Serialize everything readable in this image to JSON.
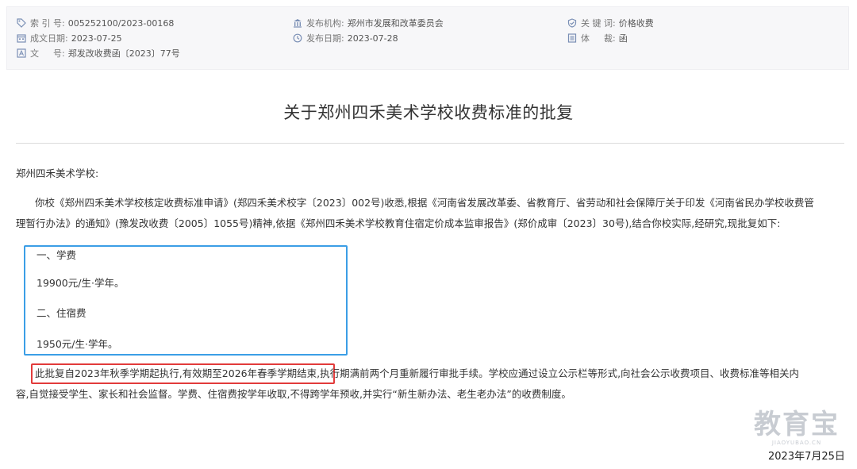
{
  "meta": {
    "index_label": "索 引 号:",
    "index_value": "005252100/2023-00168",
    "publisher_label": "发布机构:",
    "publisher_value": "郑州市发展和改革委员会",
    "keyword_label": "关 键 词:",
    "keyword_value": "价格收费",
    "created_label": "成文日期:",
    "created_value": "2023-07-25",
    "published_label": "发布日期:",
    "published_value": "2023-07-28",
    "genre_label": "体 　 裁:",
    "genre_value": "函",
    "docno_label": "文 　 号:",
    "docno_value": "郑发改收费函〔2023〕77号"
  },
  "doc": {
    "title": "关于郑州四禾美术学校收费标准的批复",
    "salutation": "郑州四禾美术学校:",
    "intro_line1": "你校《郑州四禾美术学校核定收费标准申请》(郑四禾美术校字〔2023〕002号)收悉,根据《河南省发展改革委、省教育厅、省劳动和社会保障厅关于印发《河南省民办学校收费管",
    "intro_line2": "理暂行办法》的通知》(豫发改收费〔2005〕1055号)精神,依据《郑州四禾美术学校教育住宿定价成本监审报告》(郑价成审〔2023〕30号),结合你校实际,经研究,现批复如下:",
    "fee1_heading": "一、学费",
    "fee1_value": "19900元/生·学年。",
    "fee2_heading": "二、住宿费",
    "fee2_value": "1950元/生·学年。",
    "validity_highlight": "此批复自2023年秋季学期起执行,有效期至2026年春季学期结束,",
    "validity_rest": "执行期满前两个月重新履行审批手续。学校应通过设立公示栏等形式,向社会公示收费项目、收费标准等相关内",
    "validity_line2": "容,自觉接受学生、家长和社会监督。学费、住宿费按学年收取,不得跨学年预收,并实行“新生新办法、老生老办法”的收费制度。",
    "date": "2023年7月25日"
  },
  "watermark": {
    "text": "教育宝",
    "sub": "JIAOYUBAO.CN"
  },
  "colors": {
    "icon": "#7a8fb5",
    "highlight_blue": "#3b9ee6",
    "highlight_red": "#e23b3b"
  }
}
